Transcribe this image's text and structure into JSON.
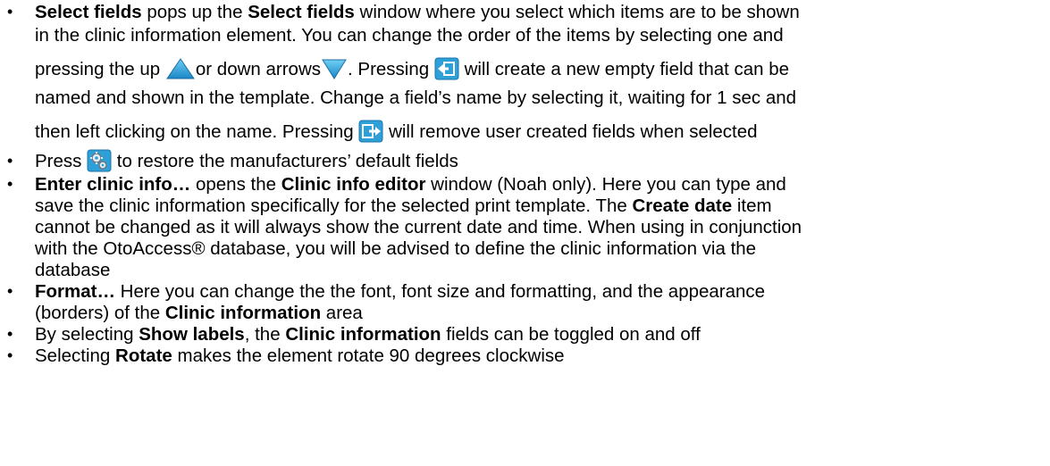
{
  "bullets": [
    {
      "lines": [
        {
          "bold1": "Select fields",
          "t1": " pops up the ",
          "bold2": "Select fields",
          "t2": " window where you select which items are to be shown"
        },
        {
          "t1": "in the clinic information element. You can change the order of the items by selecting one and"
        },
        {
          "t1": "pressing the up ",
          "t2": "or down arrows",
          "t3": ". Pressing ",
          "t4": " will create a new empty field that can be"
        },
        {
          "t1": "named and shown in the template.  Change a field’s name by selecting it, waiting for 1 sec and"
        },
        {
          "t1": "then left clicking on the name. Pressing ",
          "t2": " will remove user created fields when selected"
        }
      ]
    },
    {
      "lines": [
        {
          "t1": " Press ",
          "t2": " to restore the manufacturers’ default fields"
        }
      ]
    },
    {
      "lines": [
        {
          "bold1": "Enter clinic info…",
          "t1": " opens the ",
          "bold2": "Clinic info editor",
          "t2": " window (Noah only). Here you can type and"
        },
        {
          "t1": "save the clinic information specifically for the selected print template. The ",
          "bold1": "Create date",
          "t2": " item"
        },
        {
          "t1": "cannot be changed as it will always show the current date and time. When using in conjunction"
        },
        {
          "t1": "with the OtoAccess® database, you will be advised to define the clinic information via the"
        },
        {
          "t1": "database"
        }
      ]
    },
    {
      "lines": [
        {
          "bold1": "Format…",
          "t1": " Here you can change the the font, font size and formatting, and the appearance"
        },
        {
          "t1": "(borders) of the ",
          "bold1": "Clinic information",
          "t2": " area"
        }
      ]
    },
    {
      "lines": [
        {
          "t1": "By selecting ",
          "bold1": "Show labels",
          "t2": ", the ",
          "bold2": "Clinic information",
          "t3": " fields can be toggled on and off"
        }
      ]
    },
    {
      "lines": [
        {
          "t1": "Selecting ",
          "bold1": "Rotate",
          "t2": " makes the element rotate 90 degrees clockwise"
        }
      ]
    }
  ],
  "bullet_symbol": "•",
  "icons": {
    "up": "up-arrow-icon",
    "down": "down-arrow-icon",
    "new_field": "new-field-icon",
    "remove_field": "remove-field-icon",
    "restore_defaults": "restore-defaults-gears-icon"
  },
  "colors": {
    "text": "#000000",
    "icon_blue": "#2aa3d8",
    "icon_teal": "#1c8fb3"
  }
}
